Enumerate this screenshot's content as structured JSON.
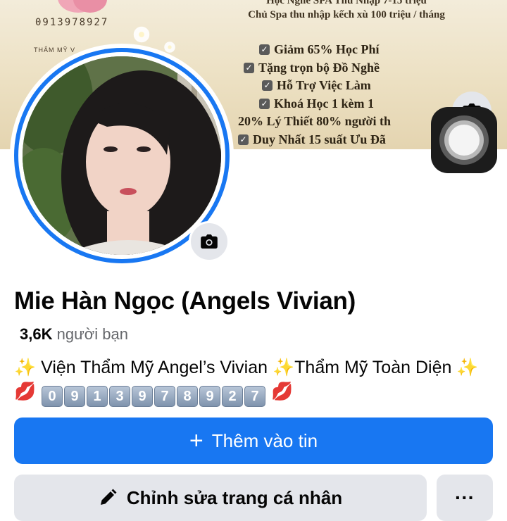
{
  "cover": {
    "phone": "0913978927",
    "brand": "THẨM MỸ V",
    "headline_line1": "Học Nghề SPA Thu Nhập 7-15 triệu",
    "headline_line2": "Chủ Spa thu nhập kếch xù 100 triệu / tháng",
    "benefits": [
      "Giảm 65% Học Phí",
      "Tặng trọn bộ Đồ Nghề",
      "Hỗ Trợ Việc Làm",
      "Khoá Học 1 kèm 1",
      "20% Lý Thiết 80% người th",
      "Duy Nhất 15 suất Ưu Đã"
    ]
  },
  "icons": {
    "cover_camera": "camera-icon",
    "avatar_camera": "camera-icon",
    "assistive_touch": "assistive-touch-icon",
    "add_story": "plus-icon",
    "edit_profile": "pencil-icon",
    "more": "ellipsis-icon"
  },
  "profile": {
    "name": "Mie Hàn Ngọc (Angels Vivian)",
    "friends_count": "3,6K",
    "friends_label": "người bạn",
    "bio_part1": "Viện Thẩm Mỹ Angel’s Vivian",
    "bio_part2": "Thẩm Mỹ Toàn Diện",
    "bio_phone_digits": [
      "0",
      "9",
      "1",
      "3",
      "9",
      "7",
      "8",
      "9",
      "2",
      "7"
    ],
    "sparkle": "✨",
    "lips": "💋"
  },
  "actions": {
    "add_story_plus": "+",
    "add_story_label": "Thêm vào tin",
    "edit_profile_label": "Chỉnh sửa trang cá nhân",
    "more_label": "···"
  },
  "colors": {
    "accent": "#1877f2",
    "button_grey": "#e4e6eb",
    "secondary_text": "#65676b"
  }
}
